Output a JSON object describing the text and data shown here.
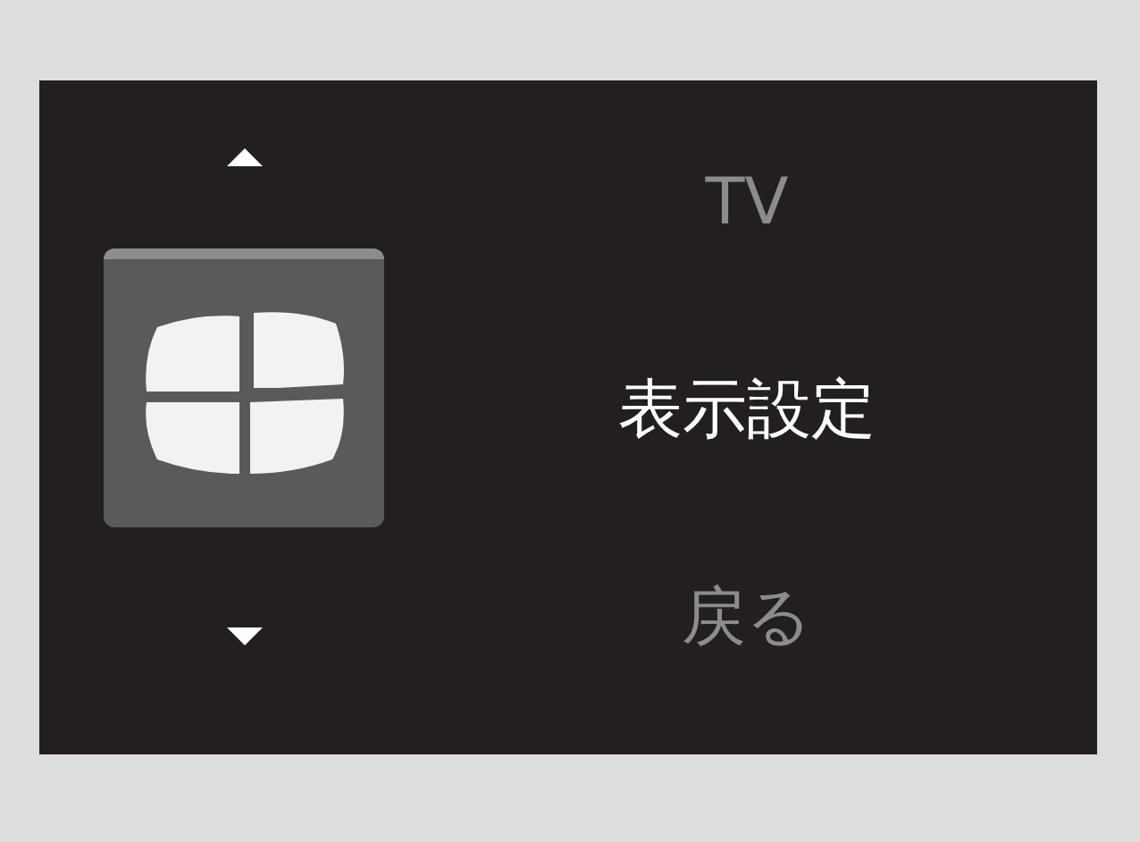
{
  "menu": {
    "items": [
      {
        "label": "TV",
        "selected": false
      },
      {
        "label": "表示設定",
        "selected": true
      },
      {
        "label": "戻る",
        "selected": false
      }
    ]
  }
}
